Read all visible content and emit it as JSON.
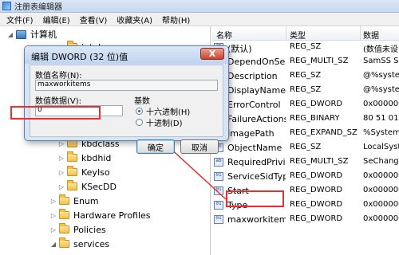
{
  "window": {
    "title": "注册表编辑器"
  },
  "menu": [
    "文件(F)",
    "编辑(E)",
    "查看(V)",
    "收藏夹(A)",
    "帮助(H)"
  ],
  "tree": {
    "root": "计算机",
    "items": [
      "intelppm",
      "kbdclass",
      "kbdhid",
      "KeyIso",
      "KSecDD",
      "Enum",
      "Hardware Profiles",
      "Policies",
      "services"
    ]
  },
  "list": {
    "columns": [
      "名称",
      "类型",
      "数据"
    ],
    "rows": [
      {
        "name": "(默认)",
        "type": "REG_SZ",
        "data": "(数值未设"
      },
      {
        "name": "DependOnSer...",
        "type": "REG_MULTI_SZ",
        "data": "SamSS Srv"
      },
      {
        "name": "Description",
        "type": "REG_SZ",
        "data": "@%system"
      },
      {
        "name": "DisplayName",
        "type": "REG_SZ",
        "data": "@%system"
      },
      {
        "name": "ErrorControl",
        "type": "REG_DWORD",
        "data": "0x000000"
      },
      {
        "name": "FailureActions",
        "type": "REG_BINARY",
        "data": "80 51 01 0"
      },
      {
        "name": "ImagePath",
        "type": "REG_EXPAND_SZ",
        "data": "%SystemR"
      },
      {
        "name": "ObjectName",
        "type": "REG_SZ",
        "data": "LocalSyste"
      },
      {
        "name": "RequiredPrivile...",
        "type": "REG_MULTI_SZ",
        "data": "SeChangeM"
      },
      {
        "name": "ServiceSidType",
        "type": "REG_DWORD",
        "data": "0x000000"
      },
      {
        "name": "Start",
        "type": "REG_DWORD",
        "data": "0x000000"
      },
      {
        "name": "Type",
        "type": "REG_DWORD",
        "data": "0x000000"
      },
      {
        "name": "maxworkitems",
        "type": "REG_DWORD",
        "data": "0x000000"
      }
    ]
  },
  "dialog": {
    "title": "编辑 DWORD (32 位)值",
    "close_label": "X",
    "value_name_label": "数值名称(N):",
    "value_name": "maxworkitems",
    "value_data_label": "数值数据(V):",
    "value_data": "0",
    "base_label": "基数",
    "hex_label": "十六进制(H)",
    "dec_label": "十进制(D)",
    "selected_base": "hex",
    "ok_label": "确定",
    "cancel_label": "取消"
  },
  "colors": {
    "annotation": "#e53030",
    "selection": "#1b5fb0"
  }
}
